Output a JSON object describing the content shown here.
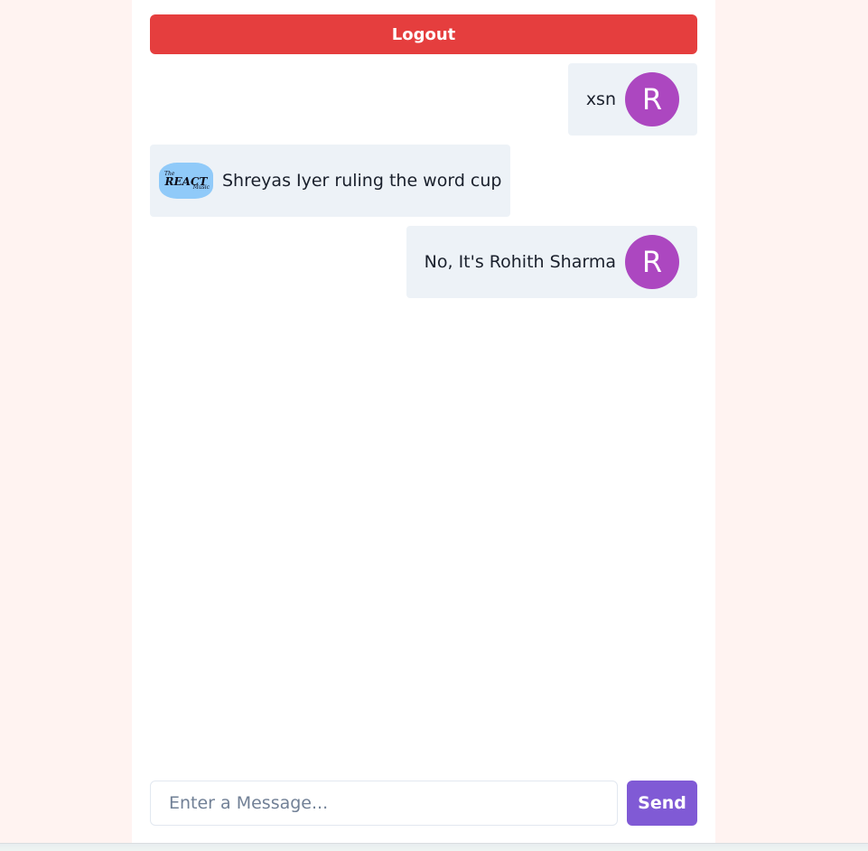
{
  "header": {
    "logout_label": "Logout"
  },
  "messages": [
    {
      "side": "right",
      "text": "xsn",
      "avatar_initial": "R",
      "avatar_color": "#ac47c0"
    },
    {
      "side": "left",
      "text": "Shreyas Iyer ruling the word cup",
      "avatar_logo": "THE REACT"
    },
    {
      "side": "right",
      "text": "No, It's Rohith Sharma",
      "avatar_initial": "R",
      "avatar_color": "#ac47c0"
    }
  ],
  "composer": {
    "input_value": "",
    "input_placeholder": "Enter a Message...",
    "send_label": "Send"
  },
  "colors": {
    "page_background": "#fff3f1",
    "logout": "#e53e3e",
    "send": "#805ad5",
    "bubble": "#edf2f7",
    "avatar": "#ac47c0"
  }
}
